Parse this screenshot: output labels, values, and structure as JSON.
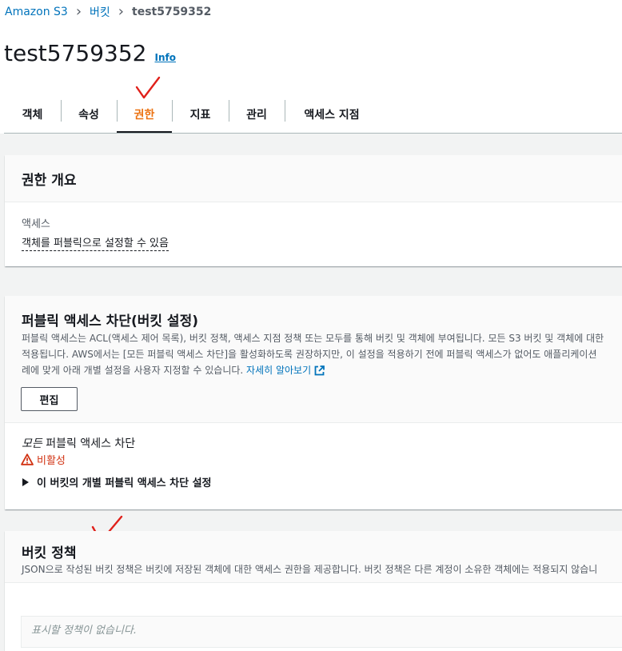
{
  "breadcrumb": {
    "items": [
      "Amazon S3",
      "버킷"
    ],
    "current": "test5759352"
  },
  "page": {
    "title": "test5759352",
    "info_link": "Info"
  },
  "tabs": [
    "객체",
    "속성",
    "권한",
    "지표",
    "관리",
    "액세스 지점"
  ],
  "active_tab": "권한",
  "permissions_overview": {
    "title": "권한 개요",
    "access_label": "액세스",
    "access_value": "객체를 퍼블릭으로 설정할 수 있음"
  },
  "block_public_access": {
    "title": "퍼블릭 액세스 차단(버킷 설정)",
    "description_line1": "퍼블릭 액세스는 ACL(액세스 제어 목록), 버킷 정책, 액세스 지점 정책 또는 모두를 통해 버킷 및 객체에 부여됩니다. 모든 S3 버킷 및 객체에 대한",
    "description_line2": "적용됩니다. AWS에서는 [모든 퍼블릭 액세스 차단]을 활성화하도록 권장하지만, 이 설정을 적용하기 전에 퍼블릭 액세스가 없어도 애플리케이션",
    "description_line3": "례에 맞게 아래 개별 설정을 사용자 지정할 수 있습니다.",
    "learn_more": "자세히 알아보기",
    "edit_button": "편집",
    "block_all_prefix": "모든",
    "block_all_label": "퍼블릭 액세스 차단",
    "status": "비활성",
    "individual_settings": "이 버킷의 개별 퍼블릭 액세스 차단 설정"
  },
  "bucket_policy": {
    "title": "버킷 정책",
    "description": "JSON으로 작성된 버킷 정책은 버킷에 저장된 객체에 대한 액세스 권한을 제공합니다. 버킷 정책은 다른 계정이 소유한 객체에는 적용되지 않습니",
    "empty_text": "표시할 정책이 없습니다."
  },
  "colors": {
    "link": "#0073bb",
    "active_tab": "#ec7211",
    "warning": "#d13212",
    "annotation": "#e0201a"
  }
}
